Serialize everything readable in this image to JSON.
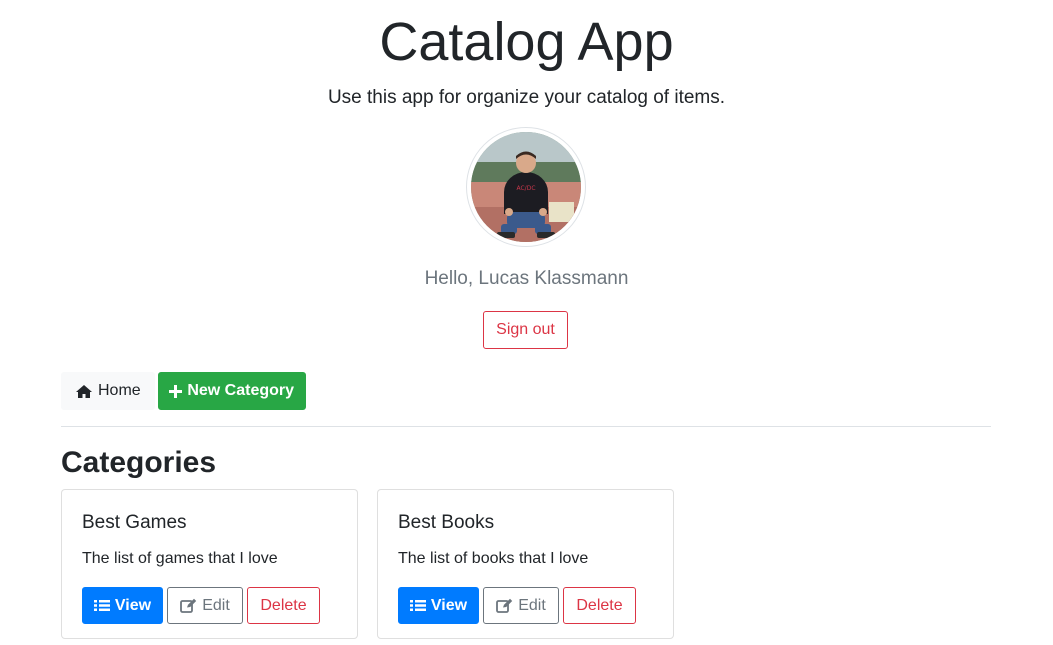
{
  "header": {
    "title": "Catalog App",
    "subtitle": "Use this app for organize your catalog of items."
  },
  "user": {
    "avatar_alt": "profile photo",
    "greeting": "Hello, Lucas Klassmann",
    "signout_label": "Sign out"
  },
  "nav": {
    "home_label": "Home",
    "home_icon": "home-icon",
    "new_category_label": "New Category",
    "new_category_icon": "plus-icon"
  },
  "section": {
    "title": "Categories"
  },
  "categories": [
    {
      "title": "Best Games",
      "description": "The list of games that I love",
      "view_label": "View",
      "edit_label": "Edit",
      "delete_label": "Delete"
    },
    {
      "title": "Best Books",
      "description": "The list of books that I love",
      "view_label": "View",
      "edit_label": "Edit",
      "delete_label": "Delete"
    }
  ],
  "colors": {
    "primary": "#007bff",
    "success": "#28a745",
    "danger": "#dc3545",
    "secondary": "#6c757d",
    "light": "#f8f9fa"
  }
}
